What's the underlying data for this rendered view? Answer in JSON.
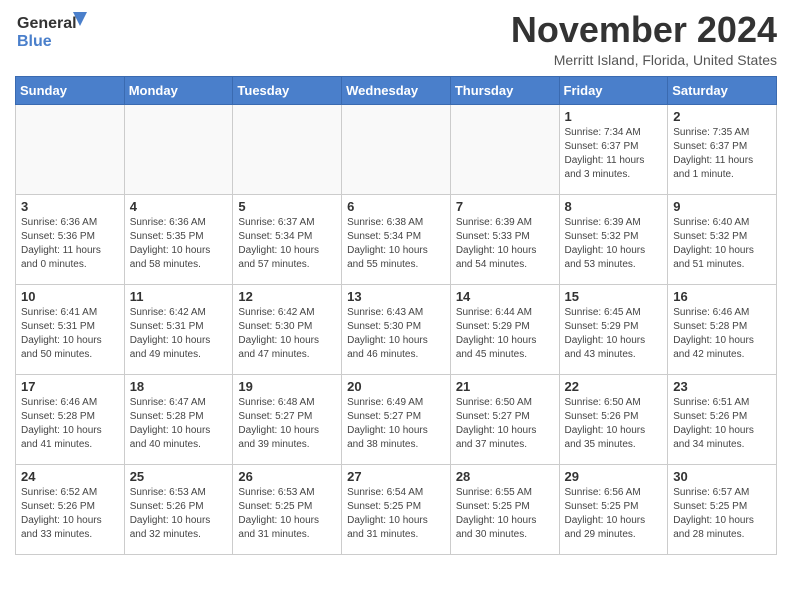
{
  "header": {
    "logo_line1": "General",
    "logo_line2": "Blue",
    "month": "November 2024",
    "location": "Merritt Island, Florida, United States"
  },
  "weekdays": [
    "Sunday",
    "Monday",
    "Tuesday",
    "Wednesday",
    "Thursday",
    "Friday",
    "Saturday"
  ],
  "weeks": [
    [
      {
        "day": "",
        "info": ""
      },
      {
        "day": "",
        "info": ""
      },
      {
        "day": "",
        "info": ""
      },
      {
        "day": "",
        "info": ""
      },
      {
        "day": "",
        "info": ""
      },
      {
        "day": "1",
        "info": "Sunrise: 7:34 AM\nSunset: 6:37 PM\nDaylight: 11 hours\nand 3 minutes."
      },
      {
        "day": "2",
        "info": "Sunrise: 7:35 AM\nSunset: 6:37 PM\nDaylight: 11 hours\nand 1 minute."
      }
    ],
    [
      {
        "day": "3",
        "info": "Sunrise: 6:36 AM\nSunset: 5:36 PM\nDaylight: 11 hours\nand 0 minutes."
      },
      {
        "day": "4",
        "info": "Sunrise: 6:36 AM\nSunset: 5:35 PM\nDaylight: 10 hours\nand 58 minutes."
      },
      {
        "day": "5",
        "info": "Sunrise: 6:37 AM\nSunset: 5:34 PM\nDaylight: 10 hours\nand 57 minutes."
      },
      {
        "day": "6",
        "info": "Sunrise: 6:38 AM\nSunset: 5:34 PM\nDaylight: 10 hours\nand 55 minutes."
      },
      {
        "day": "7",
        "info": "Sunrise: 6:39 AM\nSunset: 5:33 PM\nDaylight: 10 hours\nand 54 minutes."
      },
      {
        "day": "8",
        "info": "Sunrise: 6:39 AM\nSunset: 5:32 PM\nDaylight: 10 hours\nand 53 minutes."
      },
      {
        "day": "9",
        "info": "Sunrise: 6:40 AM\nSunset: 5:32 PM\nDaylight: 10 hours\nand 51 minutes."
      }
    ],
    [
      {
        "day": "10",
        "info": "Sunrise: 6:41 AM\nSunset: 5:31 PM\nDaylight: 10 hours\nand 50 minutes."
      },
      {
        "day": "11",
        "info": "Sunrise: 6:42 AM\nSunset: 5:31 PM\nDaylight: 10 hours\nand 49 minutes."
      },
      {
        "day": "12",
        "info": "Sunrise: 6:42 AM\nSunset: 5:30 PM\nDaylight: 10 hours\nand 47 minutes."
      },
      {
        "day": "13",
        "info": "Sunrise: 6:43 AM\nSunset: 5:30 PM\nDaylight: 10 hours\nand 46 minutes."
      },
      {
        "day": "14",
        "info": "Sunrise: 6:44 AM\nSunset: 5:29 PM\nDaylight: 10 hours\nand 45 minutes."
      },
      {
        "day": "15",
        "info": "Sunrise: 6:45 AM\nSunset: 5:29 PM\nDaylight: 10 hours\nand 43 minutes."
      },
      {
        "day": "16",
        "info": "Sunrise: 6:46 AM\nSunset: 5:28 PM\nDaylight: 10 hours\nand 42 minutes."
      }
    ],
    [
      {
        "day": "17",
        "info": "Sunrise: 6:46 AM\nSunset: 5:28 PM\nDaylight: 10 hours\nand 41 minutes."
      },
      {
        "day": "18",
        "info": "Sunrise: 6:47 AM\nSunset: 5:28 PM\nDaylight: 10 hours\nand 40 minutes."
      },
      {
        "day": "19",
        "info": "Sunrise: 6:48 AM\nSunset: 5:27 PM\nDaylight: 10 hours\nand 39 minutes."
      },
      {
        "day": "20",
        "info": "Sunrise: 6:49 AM\nSunset: 5:27 PM\nDaylight: 10 hours\nand 38 minutes."
      },
      {
        "day": "21",
        "info": "Sunrise: 6:50 AM\nSunset: 5:27 PM\nDaylight: 10 hours\nand 37 minutes."
      },
      {
        "day": "22",
        "info": "Sunrise: 6:50 AM\nSunset: 5:26 PM\nDaylight: 10 hours\nand 35 minutes."
      },
      {
        "day": "23",
        "info": "Sunrise: 6:51 AM\nSunset: 5:26 PM\nDaylight: 10 hours\nand 34 minutes."
      }
    ],
    [
      {
        "day": "24",
        "info": "Sunrise: 6:52 AM\nSunset: 5:26 PM\nDaylight: 10 hours\nand 33 minutes."
      },
      {
        "day": "25",
        "info": "Sunrise: 6:53 AM\nSunset: 5:26 PM\nDaylight: 10 hours\nand 32 minutes."
      },
      {
        "day": "26",
        "info": "Sunrise: 6:53 AM\nSunset: 5:25 PM\nDaylight: 10 hours\nand 31 minutes."
      },
      {
        "day": "27",
        "info": "Sunrise: 6:54 AM\nSunset: 5:25 PM\nDaylight: 10 hours\nand 31 minutes."
      },
      {
        "day": "28",
        "info": "Sunrise: 6:55 AM\nSunset: 5:25 PM\nDaylight: 10 hours\nand 30 minutes."
      },
      {
        "day": "29",
        "info": "Sunrise: 6:56 AM\nSunset: 5:25 PM\nDaylight: 10 hours\nand 29 minutes."
      },
      {
        "day": "30",
        "info": "Sunrise: 6:57 AM\nSunset: 5:25 PM\nDaylight: 10 hours\nand 28 minutes."
      }
    ]
  ]
}
